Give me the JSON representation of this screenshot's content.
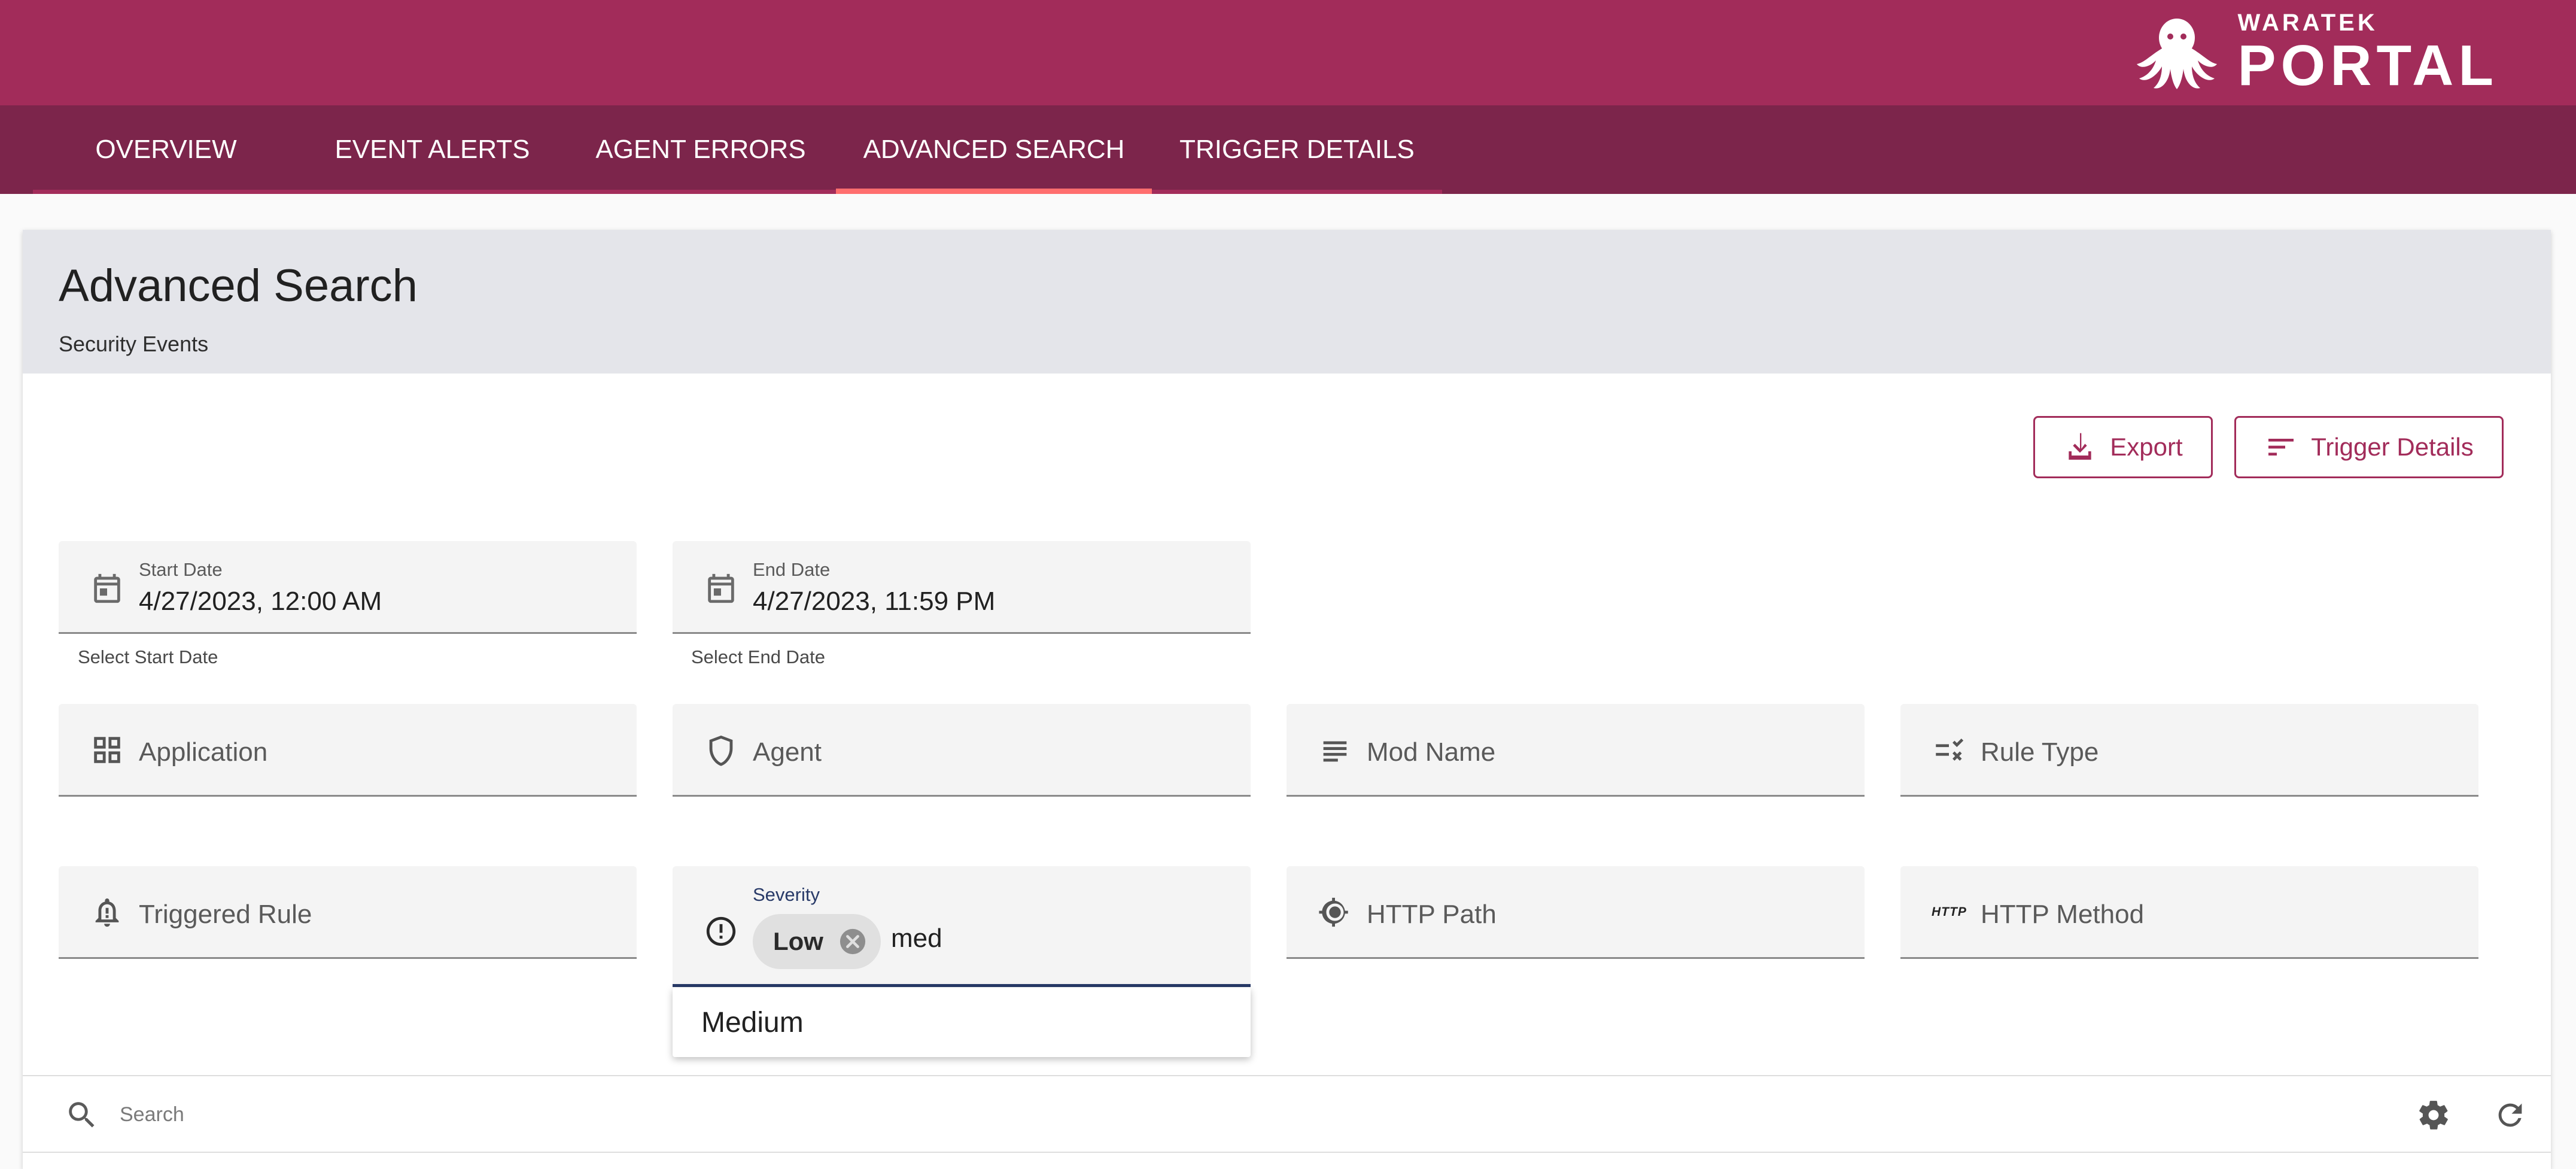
{
  "brand": {
    "small": "WARATEK",
    "big": "PORTAL"
  },
  "nav": {
    "tabs": [
      {
        "label": "OVERVIEW",
        "active": false
      },
      {
        "label": "EVENT ALERTS",
        "active": false
      },
      {
        "label": "AGENT ERRORS",
        "active": false
      },
      {
        "label": "ADVANCED SEARCH",
        "active": true
      },
      {
        "label": "TRIGGER DETAILS",
        "active": false
      }
    ]
  },
  "page": {
    "title": "Advanced Search",
    "subtitle": "Security Events"
  },
  "actions": {
    "export_label": "Export",
    "trigger_details_label": "Trigger Details"
  },
  "dates": {
    "start": {
      "label": "Start Date",
      "value": "4/27/2023, 12:00 AM",
      "hint": "Select Start Date"
    },
    "end": {
      "label": "End Date",
      "value": "4/27/2023, 11:59 PM",
      "hint": "Select End Date"
    }
  },
  "filters": {
    "application": "Application",
    "agent": "Agent",
    "mod_name": "Mod Name",
    "rule_type": "Rule Type",
    "triggered_rule": "Triggered Rule",
    "http_path": "HTTP Path",
    "http_method": "HTTP Method",
    "http_badge": "HTTP"
  },
  "severity": {
    "label": "Severity",
    "chip": "Low",
    "typed": "med",
    "options": [
      "Medium"
    ]
  },
  "table": {
    "search_placeholder": "Search"
  },
  "colors": {
    "header": "#a22c5a",
    "nav": "#7c254b",
    "active_tab_indicator": "#ff6e6e",
    "accent": "#a22c5a",
    "focus": "#283a68"
  }
}
